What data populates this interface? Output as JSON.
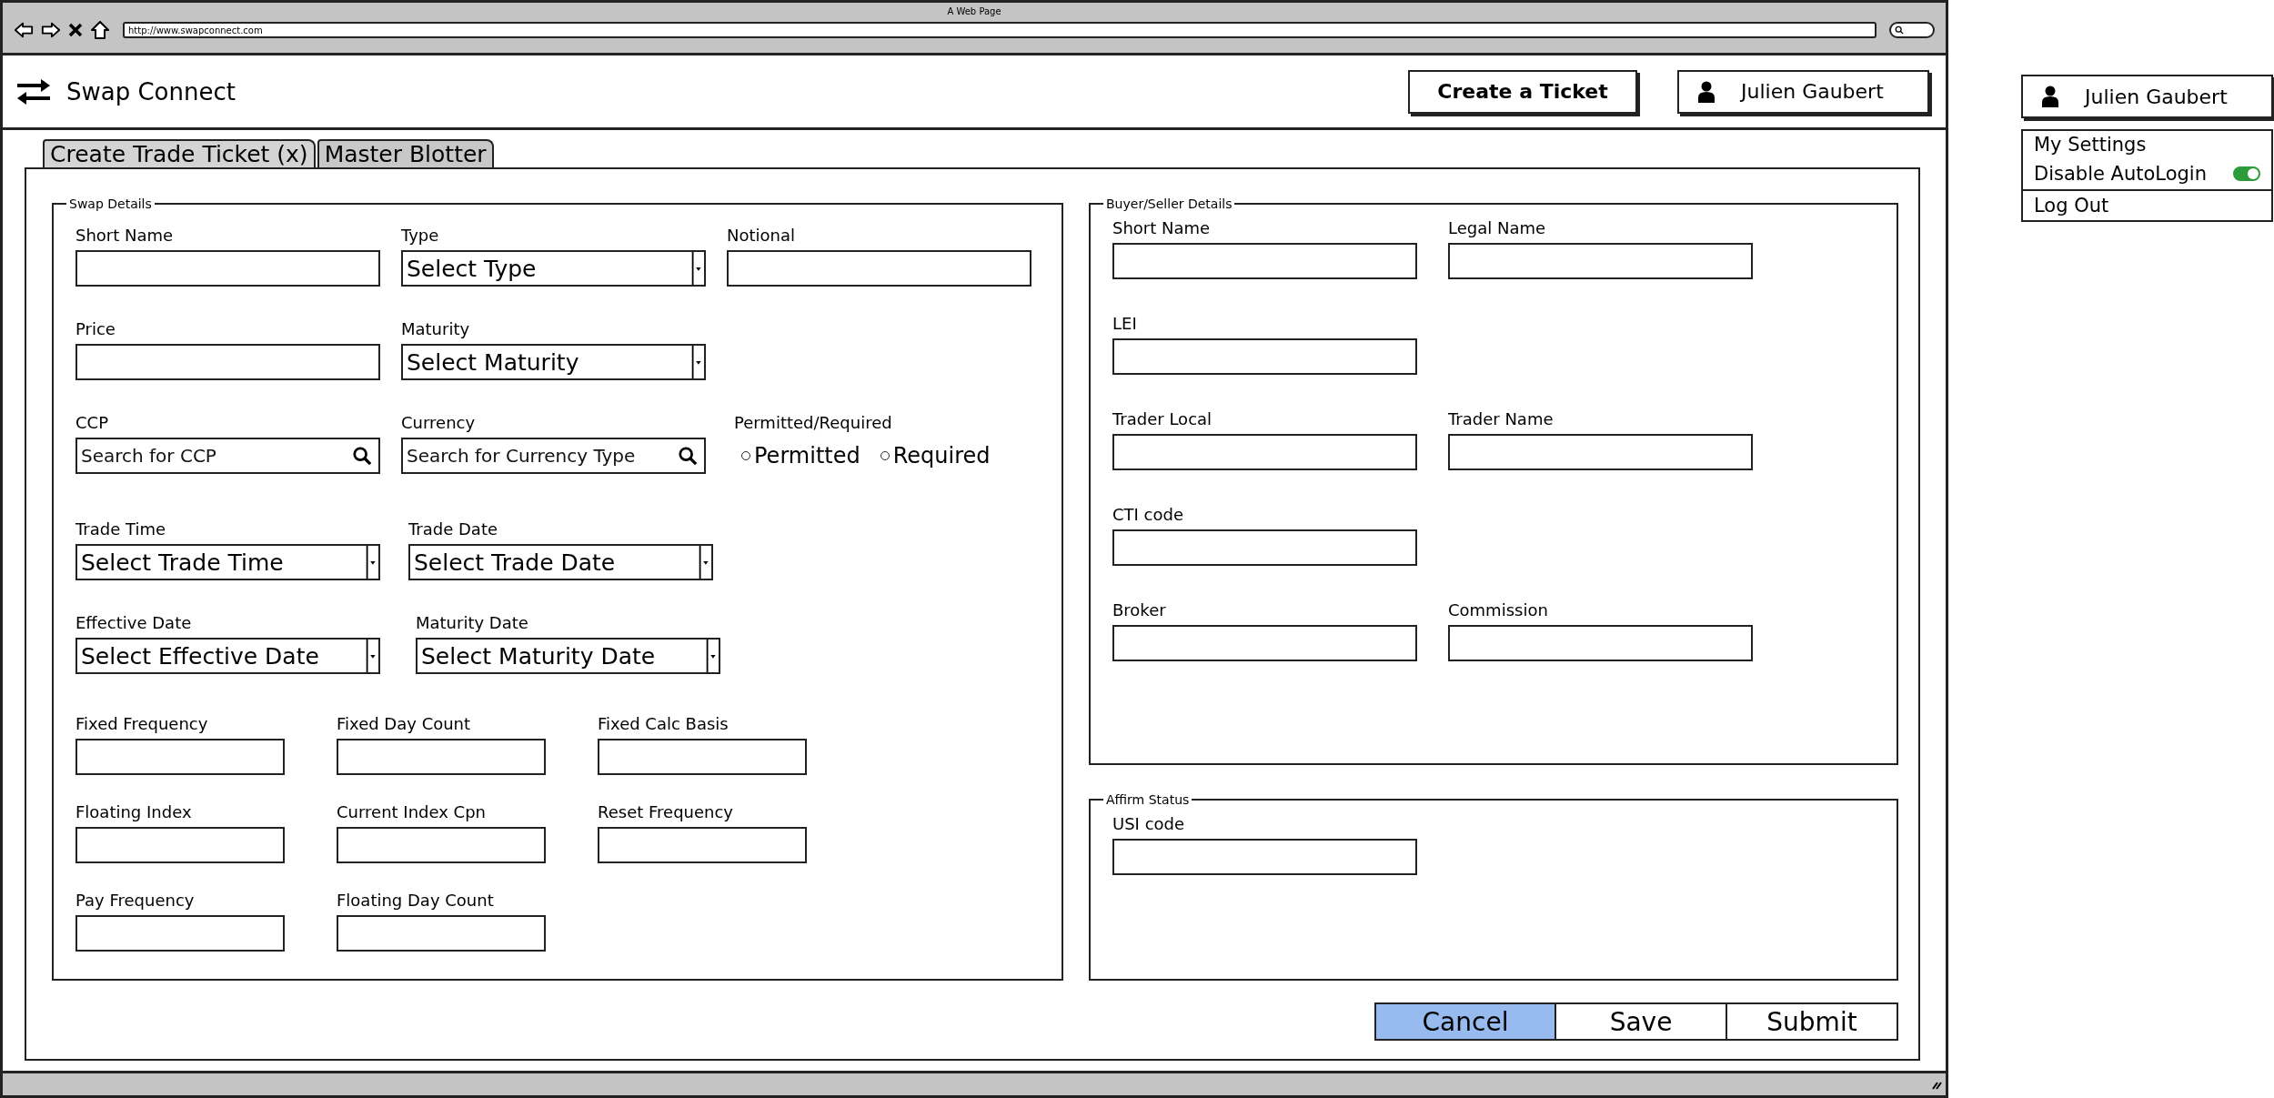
{
  "browser": {
    "title": "A Web Page",
    "url": "http://www.swapconnect.com"
  },
  "header": {
    "app_name": "Swap Connect",
    "create_button": "Create a Ticket",
    "user_button": "Julien Gaubert"
  },
  "tabs": [
    {
      "label": "Create Trade Ticket (x)",
      "selected": true
    },
    {
      "label": "Master Blotter",
      "selected": false
    }
  ],
  "swap_details": {
    "title": "Swap Details",
    "rows": [
      [
        {
          "label": "Short Name",
          "kind": "text"
        },
        {
          "label": "Type",
          "kind": "select",
          "value": "Select Type"
        },
        {
          "label": "Notional",
          "kind": "text"
        }
      ],
      [
        {
          "label": "Price",
          "kind": "text"
        },
        {
          "label": "Maturity",
          "kind": "select",
          "value": "Select Maturity"
        }
      ],
      [
        {
          "label": "CCP",
          "kind": "search",
          "placeholder": "Search for CCP"
        },
        {
          "label": "Currency",
          "kind": "search",
          "placeholder": "Search for Currency Type"
        },
        {
          "label": "Permitted/Required",
          "kind": "radio",
          "options": [
            {
              "label": "Permitted",
              "selected": false
            },
            {
              "label": "Required",
              "selected": false
            }
          ]
        }
      ],
      [
        {
          "label": "Trade Time",
          "kind": "select",
          "value": "Select Trade Time"
        },
        {
          "label": "Trade Date",
          "kind": "select",
          "value": "Select Trade Date"
        }
      ],
      [
        {
          "label": "Effective Date",
          "kind": "select",
          "value": "Select Effective Date"
        },
        {
          "label": "Maturity Date",
          "kind": "select",
          "value": "Select Maturity Date"
        }
      ],
      [
        {
          "label": "Fixed Frequency",
          "kind": "text"
        },
        {
          "label": "Fixed Day Count",
          "kind": "text"
        },
        {
          "label": "Fixed Calc Basis",
          "kind": "text"
        }
      ],
      [
        {
          "label": "Floating Index",
          "kind": "text"
        },
        {
          "label": "Current Index Cpn",
          "kind": "text"
        },
        {
          "label": "Reset Frequency",
          "kind": "text"
        }
      ],
      [
        {
          "label": "Pay Frequency",
          "kind": "text"
        },
        {
          "label": "Floating Day Count",
          "kind": "text"
        }
      ]
    ]
  },
  "buyer_seller_details": {
    "title": "Buyer/Seller Details",
    "rows": [
      [
        {
          "label": "Short Name",
          "kind": "text"
        },
        {
          "label": "Legal Name",
          "kind": "text"
        }
      ],
      [
        {
          "label": "LEI",
          "kind": "text"
        }
      ],
      [
        {
          "label": "Trader Local",
          "kind": "text"
        },
        {
          "label": "Trader Name",
          "kind": "text"
        }
      ],
      [
        {
          "label": "CTI code",
          "kind": "text"
        }
      ],
      [
        {
          "label": "Broker",
          "kind": "text"
        },
        {
          "label": "Commission",
          "kind": "text"
        }
      ]
    ]
  },
  "affirm_status": {
    "title": "Affirm Status",
    "rows": [
      [
        {
          "label": "USI code",
          "kind": "text"
        }
      ]
    ]
  },
  "actions": [
    {
      "label": "Cancel",
      "selected": true
    },
    {
      "label": "Save",
      "selected": false
    },
    {
      "label": "Submit",
      "selected": false
    }
  ],
  "user_menu": {
    "user_button": "Julien Gaubert",
    "items": [
      {
        "label": "My Settings",
        "kind": "link"
      },
      {
        "label": "Disable AutoLogin",
        "kind": "toggle",
        "on": true
      },
      {
        "label": "Log Out",
        "kind": "link"
      }
    ]
  }
}
